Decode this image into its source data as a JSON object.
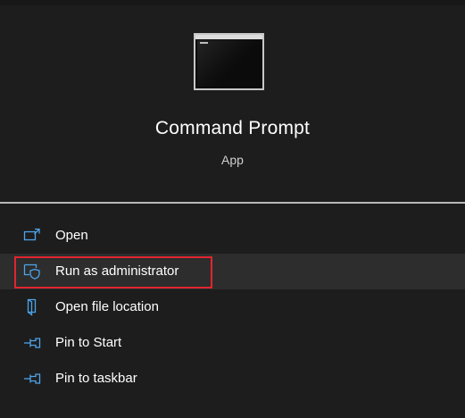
{
  "app": {
    "name": "Command Prompt",
    "type": "App",
    "icon": "command-prompt-icon"
  },
  "actions": [
    {
      "id": "open",
      "label": "Open",
      "icon": "open-window-icon"
    },
    {
      "id": "run-as-admin",
      "label": "Run as administrator",
      "icon": "admin-shield-icon",
      "hovered": true,
      "highlighted": true
    },
    {
      "id": "open-file-location",
      "label": "Open file location",
      "icon": "folder-location-icon"
    },
    {
      "id": "pin-start",
      "label": "Pin to Start",
      "icon": "pin-icon"
    },
    {
      "id": "pin-taskbar",
      "label": "Pin to taskbar",
      "icon": "pin-icon"
    }
  ],
  "colors": {
    "background": "#1d1d1d",
    "hover": "#2d2d2d",
    "icon_accent": "#4ea4ea",
    "highlight_border": "#e0252f",
    "divider": "#b8b8b8"
  }
}
